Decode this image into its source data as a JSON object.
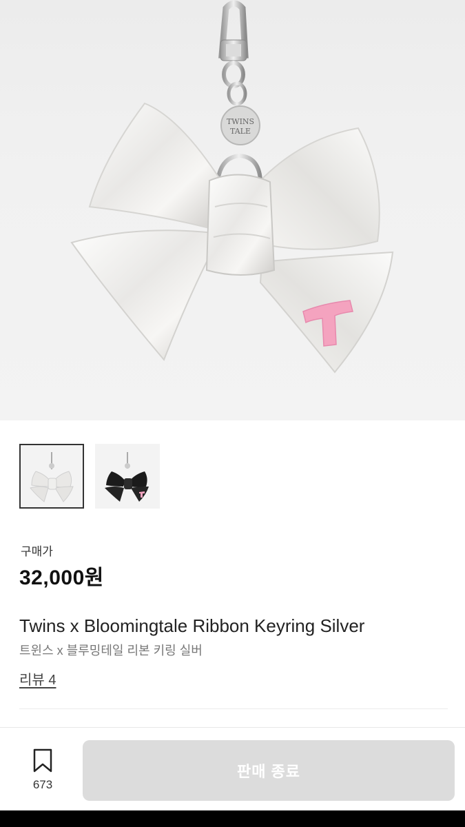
{
  "product": {
    "price_label": "구매가",
    "price": "32,000원",
    "name_en": "Twins x Bloomingtale Ribbon Keyring Silver",
    "name_ko": "트윈스 x 블루밍테일 리본 키링 실버",
    "reviews_label": "리뷰 4",
    "charm_text": "TWINS TALE",
    "charm_letter": "T"
  },
  "gallery": {
    "thumbnails": [
      {
        "variant": "silver",
        "selected": true
      },
      {
        "variant": "black",
        "selected": false
      }
    ]
  },
  "bottom_bar": {
    "bookmark_count": "673",
    "button_label": "판매 종료"
  },
  "colors": {
    "sold_button": "#dcdcdc",
    "accent_pink": "#f4a3bf"
  }
}
